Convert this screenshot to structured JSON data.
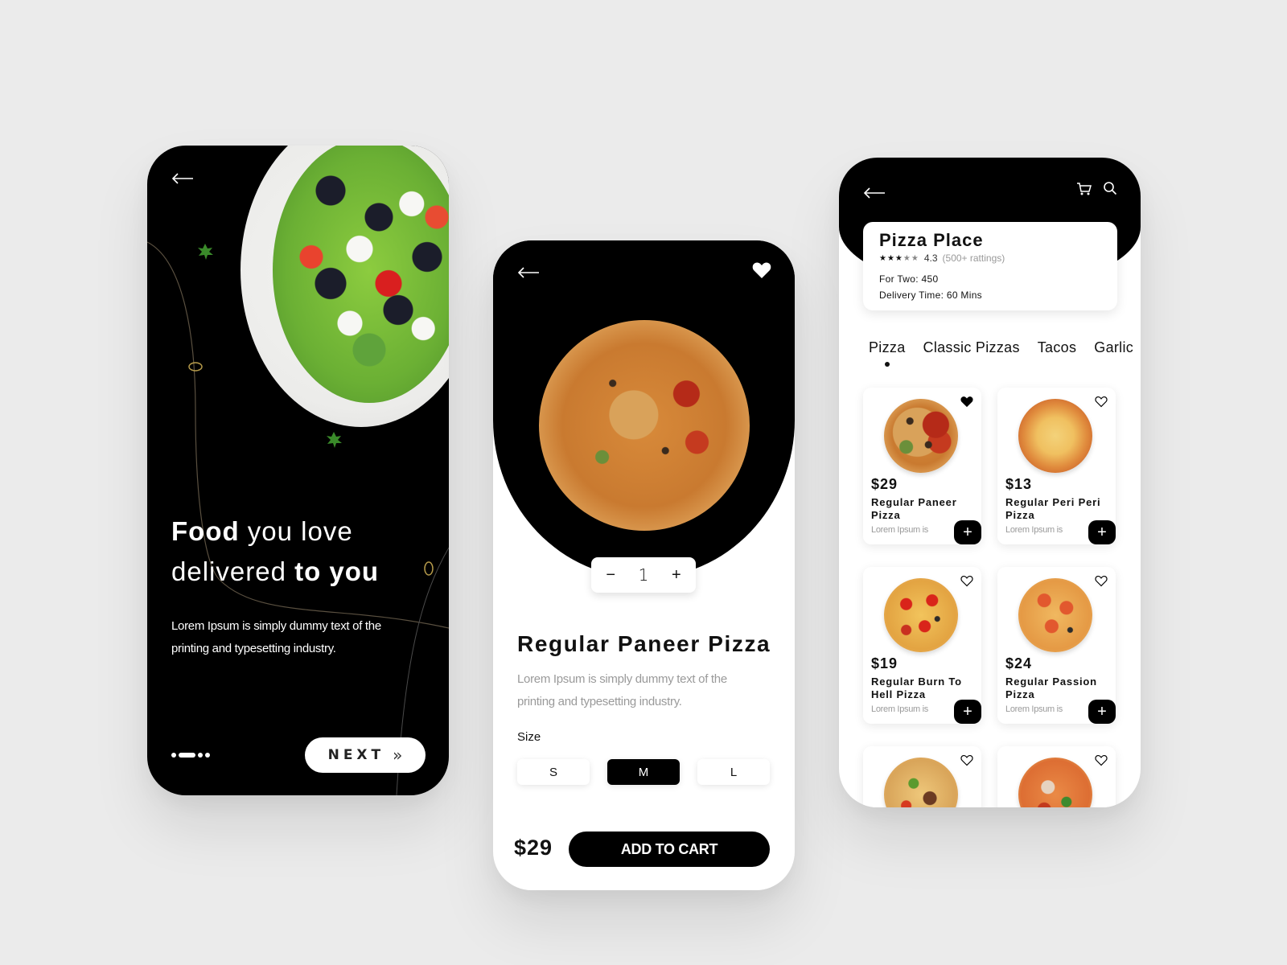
{
  "onboarding": {
    "back_icon": "arrow-left-icon",
    "title_bold_1": "Food",
    "title_light_1": " you love",
    "title_light_2": "delivered ",
    "title_bold_2": "to you",
    "description": "Lorem Ipsum is simply dummy text of the printing and typesetting industry.",
    "pagination": {
      "total": 4,
      "active_index": 1
    },
    "next_label": "NEXT",
    "next_icon": "double-chevron-right-icon"
  },
  "product": {
    "back_icon": "arrow-left-icon",
    "favorite_icon": "heart-filled-icon",
    "quantity": {
      "decrement_label": "−",
      "value": "1",
      "increment_label": "+"
    },
    "title": "Regular Paneer Pizza",
    "description": "Lorem Ipsum is simply dummy text of the printing and typesetting industry.",
    "size_label": "Size",
    "sizes": [
      {
        "label": "S",
        "selected": false
      },
      {
        "label": "M",
        "selected": true
      },
      {
        "label": "L",
        "selected": false
      }
    ],
    "price": "$29",
    "add_to_cart_label": "ADD TO CART"
  },
  "restaurant": {
    "back_icon": "arrow-left-icon",
    "cart_icon": "cart-icon",
    "search_icon": "search-icon",
    "name": "Pizza Place",
    "stars_filled": 3,
    "stars_total": 5,
    "rating": "4.3",
    "ratings_count": "(500+ rattings)",
    "for_two": "For Two: 450",
    "delivery_time": "Delivery Time: 60 Mins",
    "tabs": [
      {
        "label": "Pizza",
        "active": true
      },
      {
        "label": "Classic Pizzas",
        "active": false
      },
      {
        "label": "Tacos",
        "active": false
      },
      {
        "label": "Garlic",
        "active": false
      }
    ],
    "items": [
      {
        "price": "$29",
        "name": "Regular Paneer Pizza",
        "desc": "Lorem Ipsum is",
        "favorite": true
      },
      {
        "price": "$13",
        "name": "Regular Peri Peri Pizza",
        "desc": "Lorem Ipsum is",
        "favorite": false
      },
      {
        "price": "$19",
        "name": "Regular Burn To Hell Pizza",
        "desc": "Lorem Ipsum is",
        "favorite": false
      },
      {
        "price": "$24",
        "name": "Regular Passion Pizza",
        "desc": "Lorem Ipsum is",
        "favorite": false
      },
      {
        "price": "",
        "name": "",
        "desc": "",
        "favorite": false
      },
      {
        "price": "",
        "name": "",
        "desc": "",
        "favorite": false
      }
    ],
    "add_label": "+"
  }
}
